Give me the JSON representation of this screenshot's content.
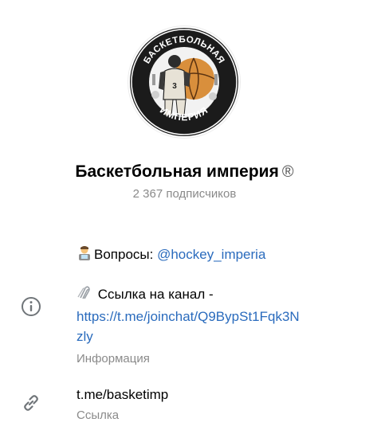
{
  "channel": {
    "title": "Баскетбольная империя",
    "title_symbol": "®",
    "subscribers": "2 367 подписчиков",
    "logo_text_top": "БАСКЕТБОЛЬНАЯ",
    "logo_text_bottom": "ИМПЕРИЯ",
    "logo_jersey_number": "3"
  },
  "info": {
    "questions_label": "Вопросы:",
    "questions_handle": "@hockey_imperia",
    "invite_label": "Ссылка на канал -",
    "invite_url_line1": "https://t.me/joinchat/Q9BypSt1Fqk3N",
    "invite_url_line2": "zly",
    "section_label": "Информация",
    "icon": "info-circle-icon"
  },
  "link": {
    "value": "t.me/basketimp",
    "label": "Ссылка",
    "icon": "link-icon"
  },
  "colors": {
    "link": "#2a6bbd",
    "secondary_text": "#8a8a8a",
    "icon": "#707579"
  }
}
